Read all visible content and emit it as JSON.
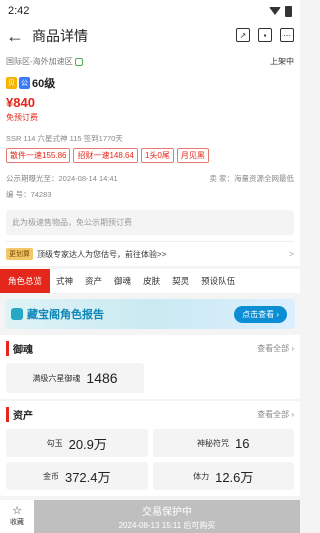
{
  "status_bar": {
    "time": "2:42"
  },
  "header": {
    "title": "商品详情"
  },
  "listing": {
    "region": "国际区-海外加速区",
    "status": "上架中",
    "badge1": "贝",
    "badge2": "公",
    "level": "60级",
    "price": "¥840",
    "free_installment": "免预订费",
    "meta": "SSR 114   六星式神 115   签到1770天",
    "tags": [
      "散件一速155.86",
      "招财一速148.64",
      "1头0尾",
      "月见黑"
    ],
    "publicity_label": "公示期曝光至：",
    "publicity_date": "2024-08-14 14:41",
    "seller_label": "卖  家：",
    "seller": "海量资源全网最低",
    "serial_label": "编  号：",
    "serial": "74283",
    "notice": "此为极速售物品，免公示期预订费",
    "promo_badge": "更划算",
    "promo_text": "顶级专家达人为您估号，前往体验>>",
    "promo_arrow": ">"
  },
  "tabs": [
    "角色总览",
    "式神",
    "资产",
    "御魂",
    "皮肤",
    "契灵",
    "预设队伍"
  ],
  "banner": {
    "title": "藏宝阁角色报告",
    "button": "点击查看 ›"
  },
  "yuhun": {
    "title": "御魂",
    "see_all": "查看全部 ›",
    "label": "满级六星御魂",
    "value": "1486"
  },
  "assets": {
    "title": "资产",
    "see_all": "查看全部 ›",
    "items": [
      {
        "label": "勾玉",
        "value": "20.9万"
      },
      {
        "label": "神秘符咒",
        "value": "16"
      },
      {
        "label": "金币",
        "value": "372.4万"
      },
      {
        "label": "体力",
        "value": "12.6万"
      }
    ]
  },
  "bottom": {
    "fav_label": "收藏",
    "protect_title": "交易保护中",
    "protect_sub": "2024-08-13 15:11 后可购买"
  }
}
